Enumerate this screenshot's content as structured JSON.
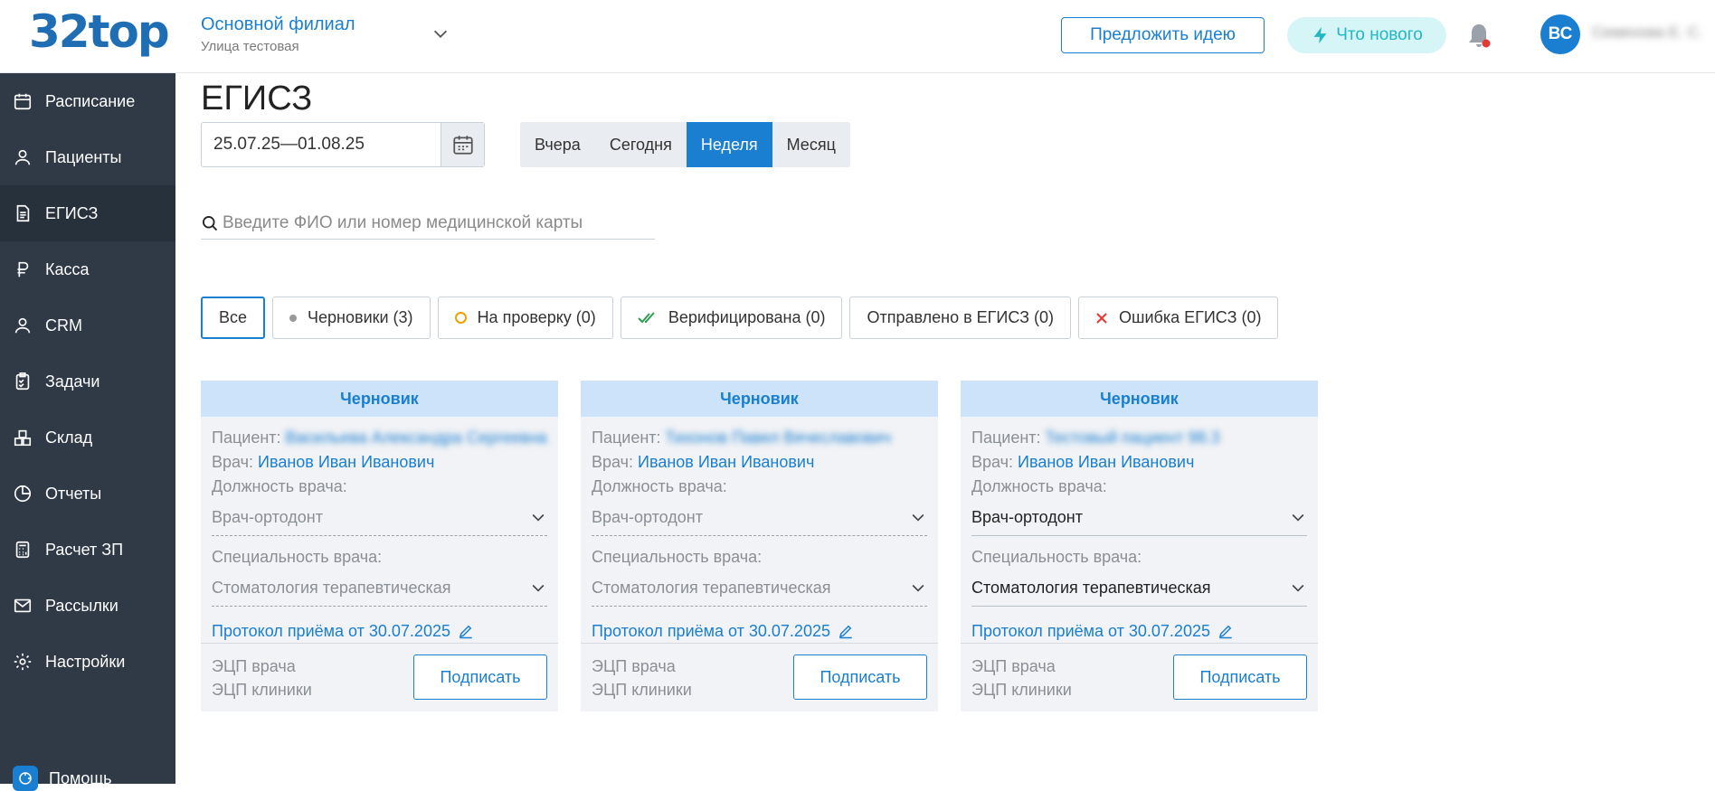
{
  "header": {
    "logo": "32top",
    "branch_name": "Основной филиал",
    "branch_address": "Улица тестовая",
    "idea_button": "Предложить идею",
    "news_button": "Что нового",
    "avatar_initials": "ВС",
    "user_name": "Семенова Е. С."
  },
  "sidebar": {
    "items": [
      {
        "label": "Расписание",
        "icon": "calendar-icon"
      },
      {
        "label": "Пациенты",
        "icon": "user-icon"
      },
      {
        "label": "ЕГИСЗ",
        "icon": "document-icon"
      },
      {
        "label": "Касса",
        "icon": "ruble-icon"
      },
      {
        "label": "CRM",
        "icon": "user-icon"
      },
      {
        "label": "Задачи",
        "icon": "tasks-icon"
      },
      {
        "label": "Склад",
        "icon": "boxes-icon"
      },
      {
        "label": "Отчеты",
        "icon": "pie-chart-icon"
      },
      {
        "label": "Расчет ЗП",
        "icon": "calculator-icon"
      },
      {
        "label": "Рассылки",
        "icon": "mail-icon"
      },
      {
        "label": "Настройки",
        "icon": "gear-icon"
      }
    ],
    "help": "Помощь"
  },
  "main": {
    "title": "ЕГИСЗ",
    "date_range": "25.07.25—01.08.25",
    "periods": [
      "Вчера",
      "Сегодня",
      "Неделя",
      "Месяц"
    ],
    "active_period": "Неделя",
    "search_placeholder": "Введите ФИО или номер медицинской карты",
    "filters": {
      "all": "Все",
      "drafts": "Черновики (3)",
      "review": "На проверку (0)",
      "verified": "Верифицирована (0)",
      "sent": "Отправлено в ЕГИСЗ (0)",
      "error": "Ошибка ЕГИСЗ (0)"
    }
  },
  "cards": [
    {
      "status": "Черновик",
      "patient_label": "Пациент:",
      "patient": "Васильева Александра Сергеевна",
      "doctor_label": "Врач:",
      "doctor": "Иванов Иван Иванович",
      "position_label": "Должность врача:",
      "position": "Врач-ортодонт",
      "specialty_label": "Специальность врача:",
      "specialty": "Стоматология терапевтическая",
      "protocol": "Протокол приёма от 30.07.2025",
      "ecp_doctor": "ЭЦП врача",
      "ecp_clinic": "ЭЦП клиники",
      "sign": "Подписать"
    },
    {
      "status": "Черновик",
      "patient_label": "Пациент:",
      "patient": "Тихонов Павел Вячеславович",
      "doctor_label": "Врач:",
      "doctor": "Иванов Иван Иванович",
      "position_label": "Должность врача:",
      "position": "Врач-ортодонт",
      "specialty_label": "Специальность врача:",
      "specialty": "Стоматология терапевтическая",
      "protocol": "Протокол приёма от 30.07.2025",
      "ecp_doctor": "ЭЦП врача",
      "ecp_clinic": "ЭЦП клиники",
      "sign": "Подписать"
    },
    {
      "status": "Черновик",
      "patient_label": "Пациент:",
      "patient": "Тестовый пациент 98.3",
      "doctor_label": "Врач:",
      "doctor": "Иванов Иван Иванович",
      "position_label": "Должность врача:",
      "position": "Врач-ортодонт",
      "specialty_label": "Специальность врача:",
      "specialty": "Стоматология терапевтическая",
      "protocol": "Протокол приёма от 30.07.2025",
      "ecp_doctor": "ЭЦП врача",
      "ecp_clinic": "ЭЦП клиники",
      "sign": "Подписать"
    }
  ],
  "colors": {
    "accent": "#1a7ed1",
    "sidebar": "#2f3a46",
    "card_header": "#cce3fa",
    "news": "#21b7c4",
    "notification": "#e53935"
  }
}
